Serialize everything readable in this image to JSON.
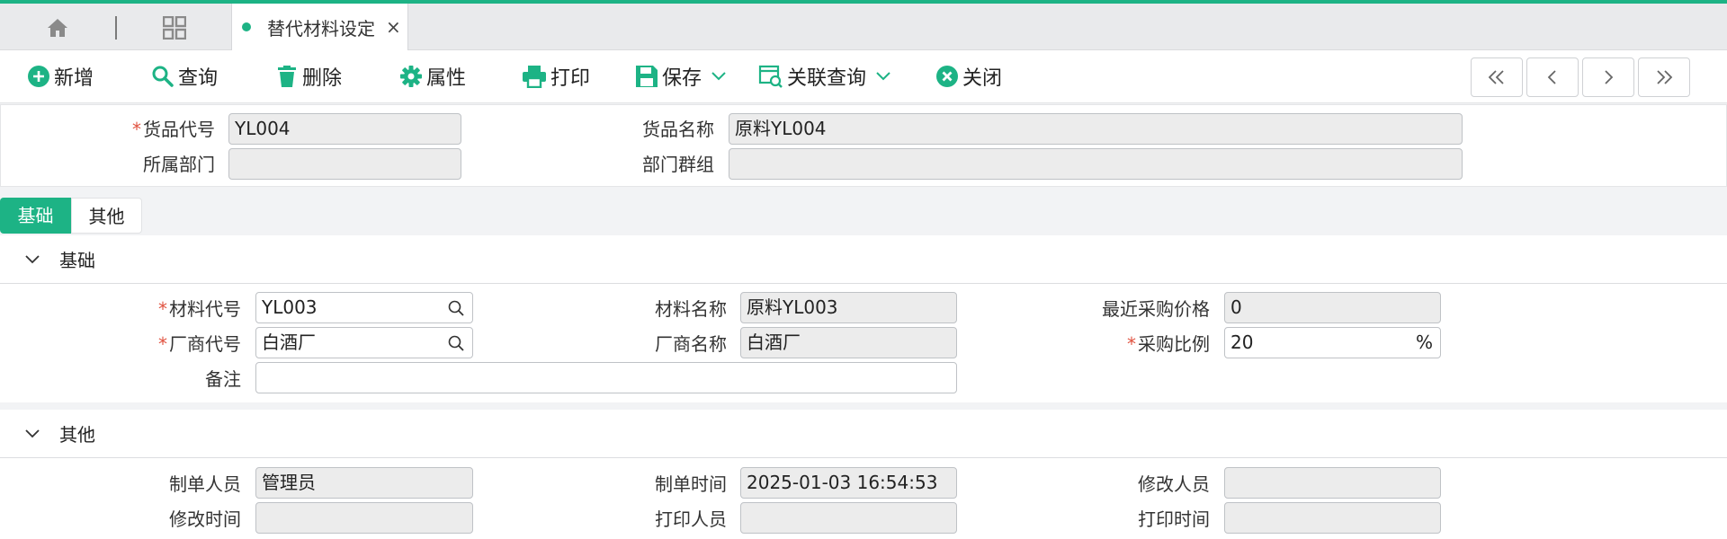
{
  "tabbar": {
    "active_tab_label": "替代材料设定",
    "close_glyph": "×"
  },
  "toolbar": {
    "add": "新增",
    "query": "查询",
    "delete": "删除",
    "properties": "属性",
    "print": "打印",
    "save": "保存",
    "related_query": "关联查询",
    "close": "关闭"
  },
  "header_form": {
    "goods_code": {
      "label": "货品代号",
      "value": "YL004",
      "required": true
    },
    "goods_name": {
      "label": "货品名称",
      "value": "原料YL004"
    },
    "department": {
      "label": "所属部门",
      "value": ""
    },
    "dept_group": {
      "label": "部门群组",
      "value": ""
    }
  },
  "content_tabs": [
    "基础",
    "其他"
  ],
  "basic_section": {
    "title": "基础",
    "material_code": {
      "label": "材料代号",
      "value": "YL003",
      "required": true
    },
    "material_name": {
      "label": "材料名称",
      "value": "原料YL003"
    },
    "last_purchase_price": {
      "label": "最近采购价格",
      "value": "0"
    },
    "vendor_code": {
      "label": "厂商代号",
      "value": "白酒厂",
      "required": true
    },
    "vendor_name": {
      "label": "厂商名称",
      "value": "白酒厂"
    },
    "purchase_ratio": {
      "label": "采购比例",
      "value": "20",
      "unit": "%",
      "required": true
    },
    "remark": {
      "label": "备注",
      "value": ""
    }
  },
  "other_section": {
    "title": "其他",
    "creator": {
      "label": "制单人员",
      "value": "管理员"
    },
    "created_time": {
      "label": "制单时间",
      "value": "2025-01-03 16:54:53"
    },
    "modifier": {
      "label": "修改人员",
      "value": ""
    },
    "modified_time": {
      "label": "修改时间",
      "value": ""
    },
    "printer": {
      "label": "打印人员",
      "value": ""
    },
    "print_time": {
      "label": "打印时间",
      "value": ""
    }
  },
  "colors": {
    "accent": "#1db385",
    "required": "#e0523f",
    "readonly_bg": "#ececec"
  },
  "icons": [
    "home-icon",
    "grid-icon",
    "plus-circle-icon",
    "search-icon",
    "trash-icon",
    "gear-icon",
    "printer-icon",
    "floppy-icon",
    "chevron-down-icon",
    "link-search-icon",
    "close-circle-icon",
    "first-page-icon",
    "prev-page-icon",
    "next-page-icon",
    "last-page-icon"
  ]
}
